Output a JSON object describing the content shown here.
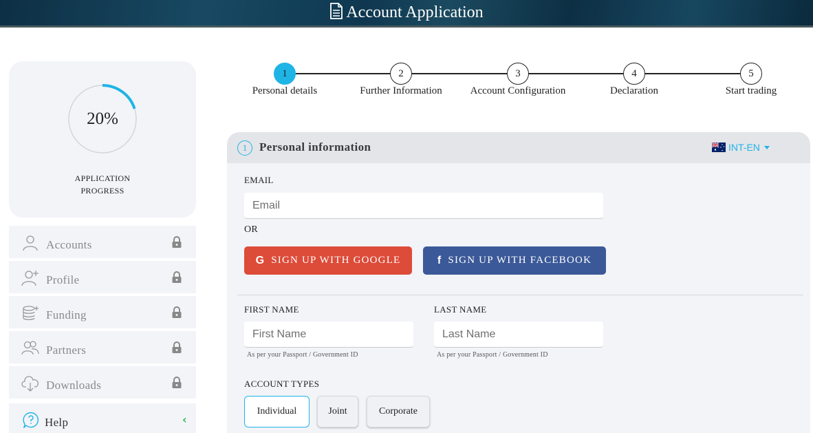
{
  "header": {
    "title": "Account Application",
    "icon": "document-icon"
  },
  "progress": {
    "value_text": "20%",
    "fraction": 0.2,
    "label_line1": "APPLICATION",
    "label_line2": "PROGRESS",
    "accent": "#1fb4e6"
  },
  "sidebar": {
    "items": [
      {
        "label": "Accounts",
        "icon": "user-icon",
        "locked": true
      },
      {
        "label": "Profile",
        "icon": "user-plus-icon",
        "locked": true
      },
      {
        "label": "Funding",
        "icon": "coins-icon",
        "locked": true
      },
      {
        "label": "Partners",
        "icon": "users-icon",
        "locked": true
      },
      {
        "label": "Downloads",
        "icon": "cloud-download-icon",
        "locked": true
      },
      {
        "label": "Help",
        "icon": "help-icon",
        "chevron": "‹"
      }
    ]
  },
  "stepper": {
    "steps": [
      {
        "num": "1",
        "label": "Personal details",
        "active": true
      },
      {
        "num": "2",
        "label": "Further Information"
      },
      {
        "num": "3",
        "label": "Account Configuration"
      },
      {
        "num": "4",
        "label": "Declaration"
      },
      {
        "num": "5",
        "label": "Start trading"
      }
    ]
  },
  "form": {
    "section_number": "1",
    "section_title": "Personal information",
    "language": "INT-EN",
    "email_label": "EMAIL",
    "email_placeholder": "Email",
    "or_text": "OR",
    "google_button": "SIGN UP WITH GOOGLE",
    "facebook_button": "SIGN UP WITH FACEBOOK",
    "first_name_label": "FIRST NAME",
    "first_name_placeholder": "First Name",
    "last_name_label": "LAST NAME",
    "last_name_placeholder": "Last Name",
    "name_hint": "As per your Passport / Government ID",
    "account_types_label": "ACCOUNT TYPES",
    "account_types": [
      "Individual",
      "Joint",
      "Corporate"
    ],
    "selected_account_type": "Individual"
  },
  "colors": {
    "google": "#dd4b39",
    "facebook": "#3b5998",
    "accent": "#1fb4e6",
    "help_chevron": "#2fb84d"
  }
}
